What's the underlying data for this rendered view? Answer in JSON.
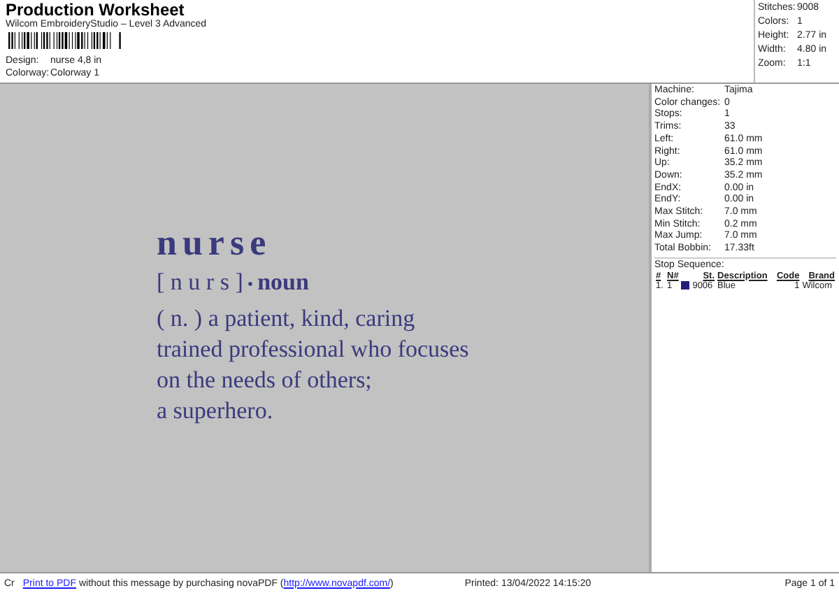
{
  "header": {
    "title": "Production Worksheet",
    "subtitle": "Wilcom EmbroideryStudio – Level 3 Advanced",
    "fields": [
      {
        "label": "Design:",
        "value": "nurse 4,8 in"
      },
      {
        "label": "Colorway:",
        "value": "Colorway 1"
      }
    ]
  },
  "summary": [
    {
      "label": "Stitches:",
      "value": "9008"
    },
    {
      "label": "Colors:",
      "value": "1"
    },
    {
      "label": "Height:",
      "value": "2.77 in"
    },
    {
      "label": "Width:",
      "value": "4.80 in"
    },
    {
      "label": "Zoom:",
      "value": "1:1"
    }
  ],
  "design": {
    "title": "nurse",
    "pronunciation": "[ n u r s ]",
    "bullet": "•",
    "part_of_speech": "noun",
    "definition_lines": [
      "( n. ) a patient, kind, caring",
      "trained professional who focuses",
      "on the needs of others;",
      "a superhero."
    ]
  },
  "machine_info": [
    {
      "label": "Machine:",
      "value": "Tajima"
    },
    {
      "label": "Color changes:",
      "value": "0"
    },
    {
      "label": "Stops:",
      "value": "1"
    },
    {
      "label": "Trims:",
      "value": "33"
    },
    {
      "label": "Left:",
      "value": "61.0 mm"
    },
    {
      "label": "Right:",
      "value": "61.0 mm"
    },
    {
      "label": "Up:",
      "value": "35.2 mm"
    },
    {
      "label": "Down:",
      "value": "35.2 mm"
    },
    {
      "label": "EndX:",
      "value": "0.00 in"
    },
    {
      "label": "EndY:",
      "value": "0.00 in"
    },
    {
      "label": "Max Stitch:",
      "value": "7.0 mm"
    },
    {
      "label": "Min Stitch:",
      "value": "0.2 mm"
    },
    {
      "label": "Max Jump:",
      "value": "7.0 mm"
    },
    {
      "label": "Total Bobbin:",
      "value": "17.33ft"
    }
  ],
  "stop_sequence": {
    "title": "Stop Sequence:",
    "columns": [
      "#",
      "N#",
      "St.",
      "Description",
      "Code",
      "Brand"
    ],
    "rows": [
      {
        "index": "1.",
        "needle": "1",
        "color": "#1f1f7a",
        "stitches": "9006",
        "description": "Blue",
        "code": "1",
        "brand": "Wilcom"
      }
    ]
  },
  "footer": {
    "cut_text": "Cr",
    "link": "Print to PDF",
    "message": "without this message by purchasing novaPDF (",
    "url": "http://www.novapdf.com/",
    "message_end": ")",
    "printed": "Printed: 13/04/2022 14:15:20",
    "page": "Page 1 of 1"
  }
}
